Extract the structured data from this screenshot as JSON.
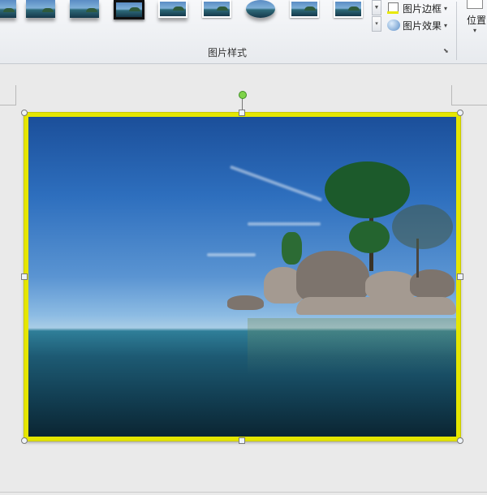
{
  "ribbon": {
    "picture_styles_group_label": "图片样式",
    "picture_border_label": "图片边框",
    "picture_effects_label": "图片效果",
    "position_label": "位置",
    "dropdown_arrow": "▾",
    "gallery_scroll_down": "▼",
    "gallery_more": "▾",
    "dialog_launcher": "⬊",
    "style_thumbnails": [
      {
        "icon": "picture-style-simple"
      },
      {
        "icon": "picture-style-soft-edge"
      },
      {
        "icon": "picture-style-reflected"
      },
      {
        "icon": "picture-style-thick-black-frame"
      },
      {
        "icon": "picture-style-drop-shadow"
      },
      {
        "icon": "picture-style-simple-frame"
      },
      {
        "icon": "picture-style-oval"
      },
      {
        "icon": "picture-style-white-frame"
      },
      {
        "icon": "picture-style-black-frame"
      }
    ]
  },
  "picture": {
    "border_color": "#e5e600",
    "rotation_handle_color": "#7fd34a",
    "content": "seascape photo with rocky island and trees"
  }
}
